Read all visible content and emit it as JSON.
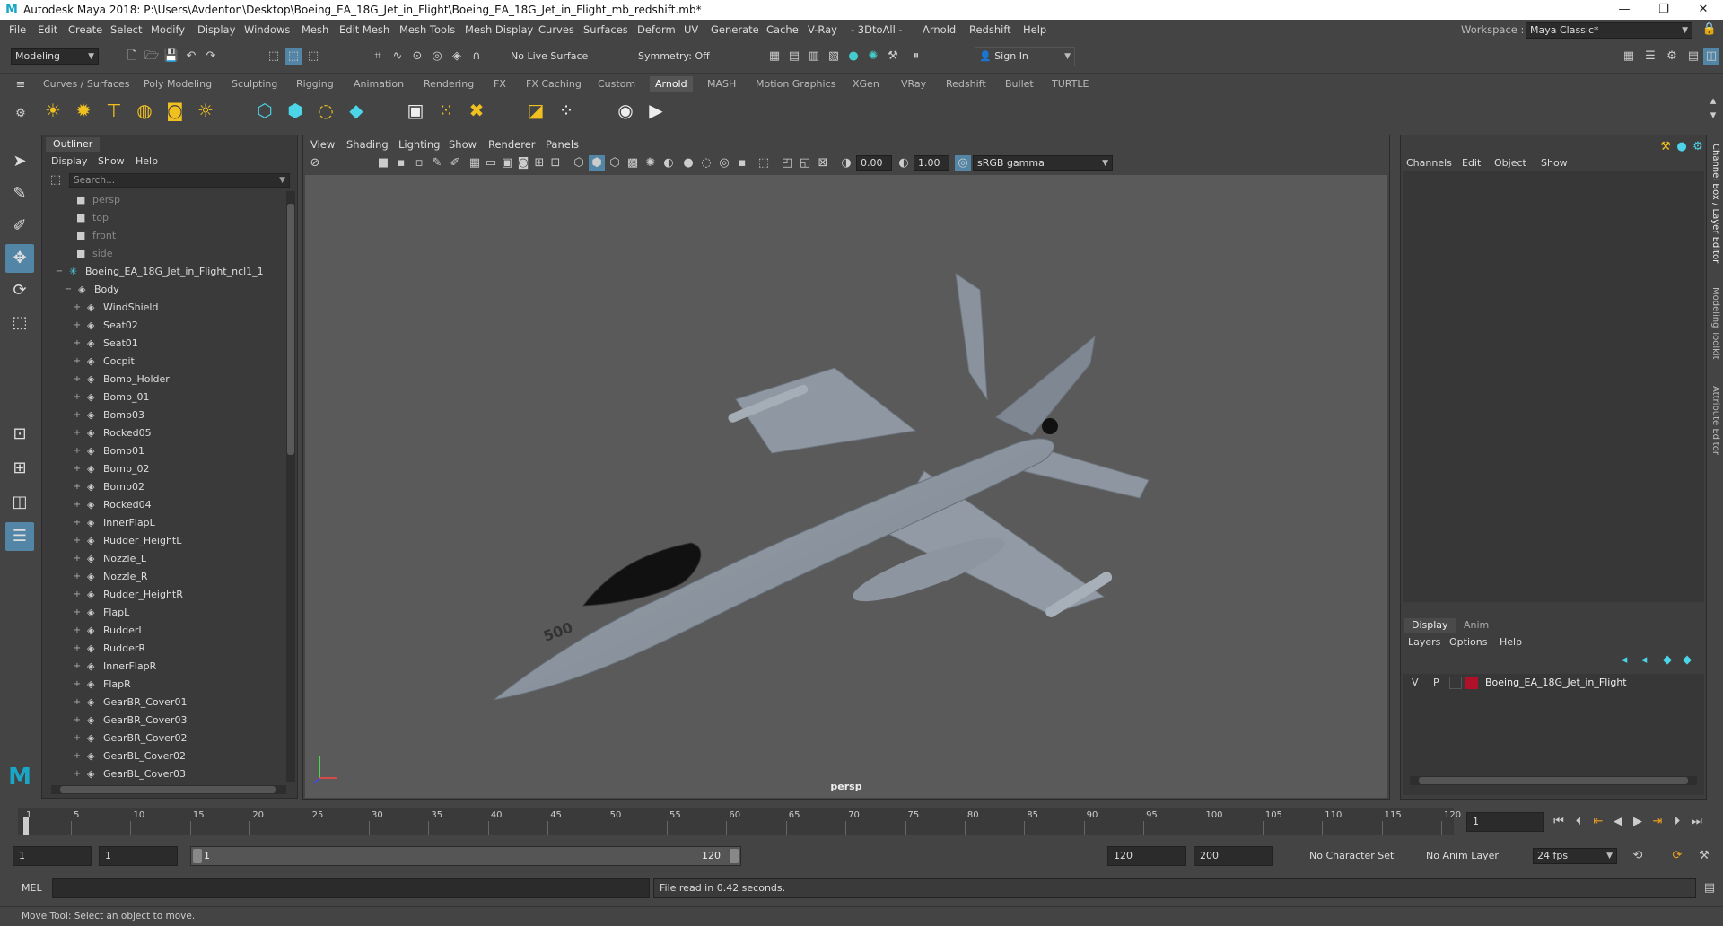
{
  "window": {
    "title": "Autodesk Maya 2018: P:\\Users\\Avdenton\\Desktop\\Boeing_EA_18G_Jet_in_Flight\\Boeing_EA_18G_Jet_in_Flight_mb_redshift.mb*",
    "minimize": "—",
    "maximize": "❐",
    "close": "✕"
  },
  "menubar": {
    "items": [
      "File",
      "Edit",
      "Create",
      "Select",
      "Modify",
      "Display",
      "Windows",
      "Mesh",
      "Edit Mesh",
      "Mesh Tools",
      "Mesh Display",
      "Curves",
      "Surfaces",
      "Deform",
      "UV",
      "Generate",
      "Cache",
      "V-Ray",
      "- 3DtoAll -",
      "Arnold",
      "Redshift",
      "Help"
    ],
    "workspace_label": "Workspace :",
    "workspace_value": "Maya Classic*"
  },
  "statusline": {
    "mode": "Modeling",
    "live_surface": "No Live Surface",
    "symmetry": "Symmetry: Off",
    "sign_in": "Sign In"
  },
  "shelf": {
    "tabs": [
      "Curves / Surfaces",
      "Poly Modeling",
      "Sculpting",
      "Rigging",
      "Animation",
      "Rendering",
      "FX",
      "FX Caching",
      "Custom",
      "Arnold",
      "MASH",
      "Motion Graphics",
      "XGen",
      "VRay",
      "Redshift",
      "Bullet",
      "TURTLE"
    ],
    "active_tab": "Arnold"
  },
  "outliner": {
    "tab": "Outliner",
    "menus": [
      "Display",
      "Show",
      "Help"
    ],
    "search_placeholder": "Search...",
    "cameras": [
      "persp",
      "top",
      "front",
      "side"
    ],
    "root": "Boeing_EA_18G_Jet_in_Flight_ncl1_1",
    "group": "Body",
    "children": [
      "WindShield",
      "Seat02",
      "Seat01",
      "Cocpit",
      "Bomb_Holder",
      "Bomb_01",
      "Bomb03",
      "Rocked05",
      "Bomb01",
      "Bomb_02",
      "Bomb02",
      "Rocked04",
      "InnerFlapL",
      "Rudder_HeightL",
      "Nozzle_L",
      "Nozzle_R",
      "Rudder_HeightR",
      "FlapL",
      "RudderL",
      "RudderR",
      "InnerFlapR",
      "FlapR",
      "GearBR_Cover01",
      "GearBR_Cover03",
      "GearBR_Cover02",
      "GearBL_Cover02",
      "GearBL_Cover03"
    ]
  },
  "viewport": {
    "menus": [
      "View",
      "Shading",
      "Lighting",
      "Show",
      "Renderer",
      "Panels"
    ],
    "exposure": "0.00",
    "gamma": "1.00",
    "color_space": "sRGB gamma",
    "camera_label": "persp",
    "jet_number": "500"
  },
  "channelbox": {
    "menus": [
      "Channels",
      "Edit",
      "Object",
      "Show"
    ],
    "layer_tabs": [
      "Display",
      "Anim"
    ],
    "active_layer_tab": "Display",
    "layer_menus": [
      "Layers",
      "Options",
      "Help"
    ],
    "layer": {
      "v": "V",
      "p": "P",
      "name": "Boeing_EA_18G_Jet_in_Flight",
      "color": "#b0102a"
    },
    "side_tabs": [
      "Channel Box / Layer Editor",
      "Modeling Toolkit",
      "Attribute Editor"
    ]
  },
  "timeline": {
    "ticks": [
      "1",
      "5",
      "10",
      "15",
      "20",
      "25",
      "30",
      "35",
      "40",
      "45",
      "50",
      "55",
      "60",
      "65",
      "70",
      "75",
      "80",
      "85",
      "90",
      "95",
      "100",
      "105",
      "110",
      "115",
      "120"
    ],
    "current_frame": "1"
  },
  "range": {
    "start": "1",
    "playback_start": "1",
    "slider_start": "1",
    "slider_end": "120",
    "playback_end": "120",
    "end": "200",
    "character_set": "No Character Set",
    "anim_layer": "No Anim Layer",
    "fps": "24 fps"
  },
  "cmdline": {
    "label": "MEL",
    "result": "File read in  0.42 seconds."
  },
  "helpline": {
    "text": "Move Tool: Select an object to move."
  },
  "colors": {
    "accent": "#5285a6",
    "bg": "#444444",
    "viewport_bg": "#5a5a5a"
  }
}
